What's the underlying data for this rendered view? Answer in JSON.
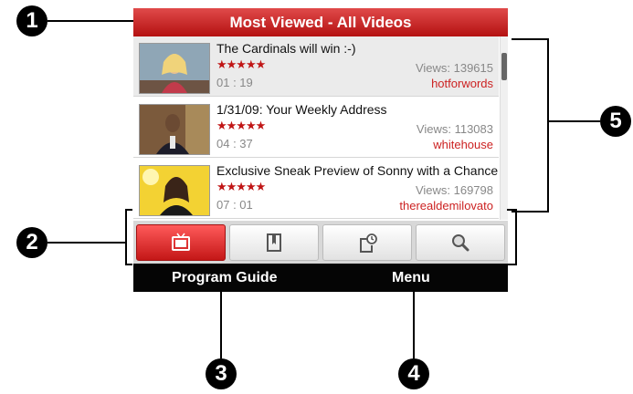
{
  "screen": {
    "title": "Most Viewed - All Videos",
    "videos": [
      {
        "title": "The Cardinals will win :-)",
        "rating": "★★★★★",
        "duration": "01 : 19",
        "views": "Views: 139615",
        "user": "hotforwords"
      },
      {
        "title": "1/31/09: Your Weekly Address",
        "rating": "★★★★★",
        "duration": "04 : 37",
        "views": "Views: 113083",
        "user": "whitehouse"
      },
      {
        "title": "Exclusive Sneak Preview of Sonny with a Chance",
        "rating": "★★★★★",
        "duration": "07 : 01",
        "views": "Views: 169798",
        "user": "therealdemilovato"
      }
    ],
    "tabs": [
      {
        "icon": "tv-icon",
        "active": true
      },
      {
        "icon": "bookmark-icon",
        "active": false
      },
      {
        "icon": "history-clock-icon",
        "active": false
      },
      {
        "icon": "search-icon",
        "active": false
      }
    ],
    "softkeys": {
      "left": "Program Guide",
      "right": "Menu"
    }
  },
  "callouts": [
    "1",
    "2",
    "3",
    "4",
    "5"
  ],
  "colors": {
    "accent_red": "#c41717",
    "soft_bar": "#050505",
    "user_red": "#cc2222"
  }
}
